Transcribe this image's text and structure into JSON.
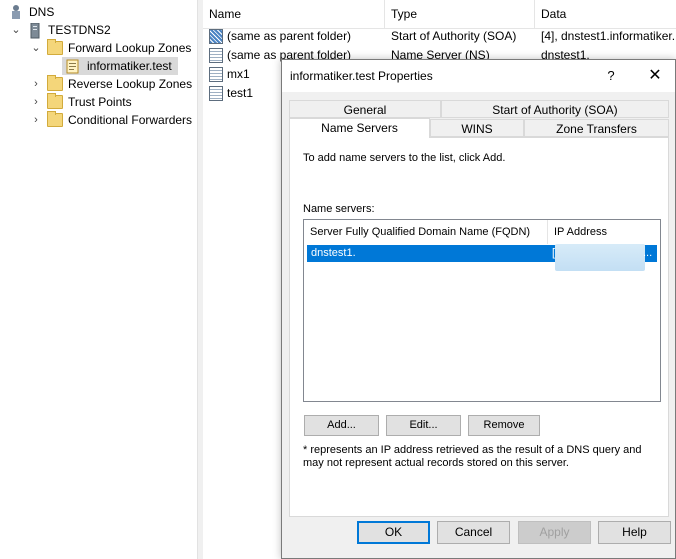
{
  "tree": {
    "root_label": "DNS",
    "server_label": "TESTDNS2",
    "forward_zones_label": "Forward Lookup Zones",
    "selected_zone_label": "informatiker.test",
    "reverse_zones_label": "Reverse Lookup Zones",
    "trust_points_label": "Trust Points",
    "conditional_forwarders_label": "Conditional Forwarders"
  },
  "list": {
    "columns": {
      "name": "Name",
      "type": "Type",
      "data": "Data"
    },
    "rows": [
      {
        "name": "(same as parent folder)",
        "type": "Start of Authority (SOA)",
        "data": "[4], dnstest1.informatiker.",
        "icon": "soa-record-icon"
      },
      {
        "name": "(same as parent folder)",
        "type": "Name Server (NS)",
        "data": "dnstest1.",
        "icon": "record-icon"
      },
      {
        "name": "mx1",
        "type": "",
        "data": "",
        "icon": "record-icon"
      },
      {
        "name": "test1",
        "type": "",
        "data": "",
        "icon": "record-icon"
      }
    ]
  },
  "dialog": {
    "title": "informatiker.test Properties",
    "help_glyph": "?",
    "close_glyph": "✕",
    "tabs": {
      "general": "General",
      "soa": "Start of Authority (SOA)",
      "name_servers": "Name Servers",
      "wins": "WINS",
      "zone_transfers": "Zone Transfers"
    },
    "instruction": "To add name servers to the list, click Add.",
    "name_servers_label": "Name servers:",
    "ns_columns": {
      "fqdn": "Server Fully Qualified Domain Name (FQDN)",
      "ip": "IP Address"
    },
    "ns_rows": [
      {
        "fqdn": "dnstest1.",
        "ip_prefix": "[",
        "ip_suffix": "..."
      }
    ],
    "buttons": {
      "add": "Add...",
      "edit": "Edit...",
      "remove": "Remove"
    },
    "note": "* represents an IP address retrieved as the result of a DNS query and may not represent actual records stored on this server.",
    "footer": {
      "ok": "OK",
      "cancel": "Cancel",
      "apply": "Apply",
      "help": "Help"
    }
  },
  "colors": {
    "selection": "#0078d7",
    "dialog_bg": "#f0f0f0",
    "folder": "#f4d67a"
  }
}
